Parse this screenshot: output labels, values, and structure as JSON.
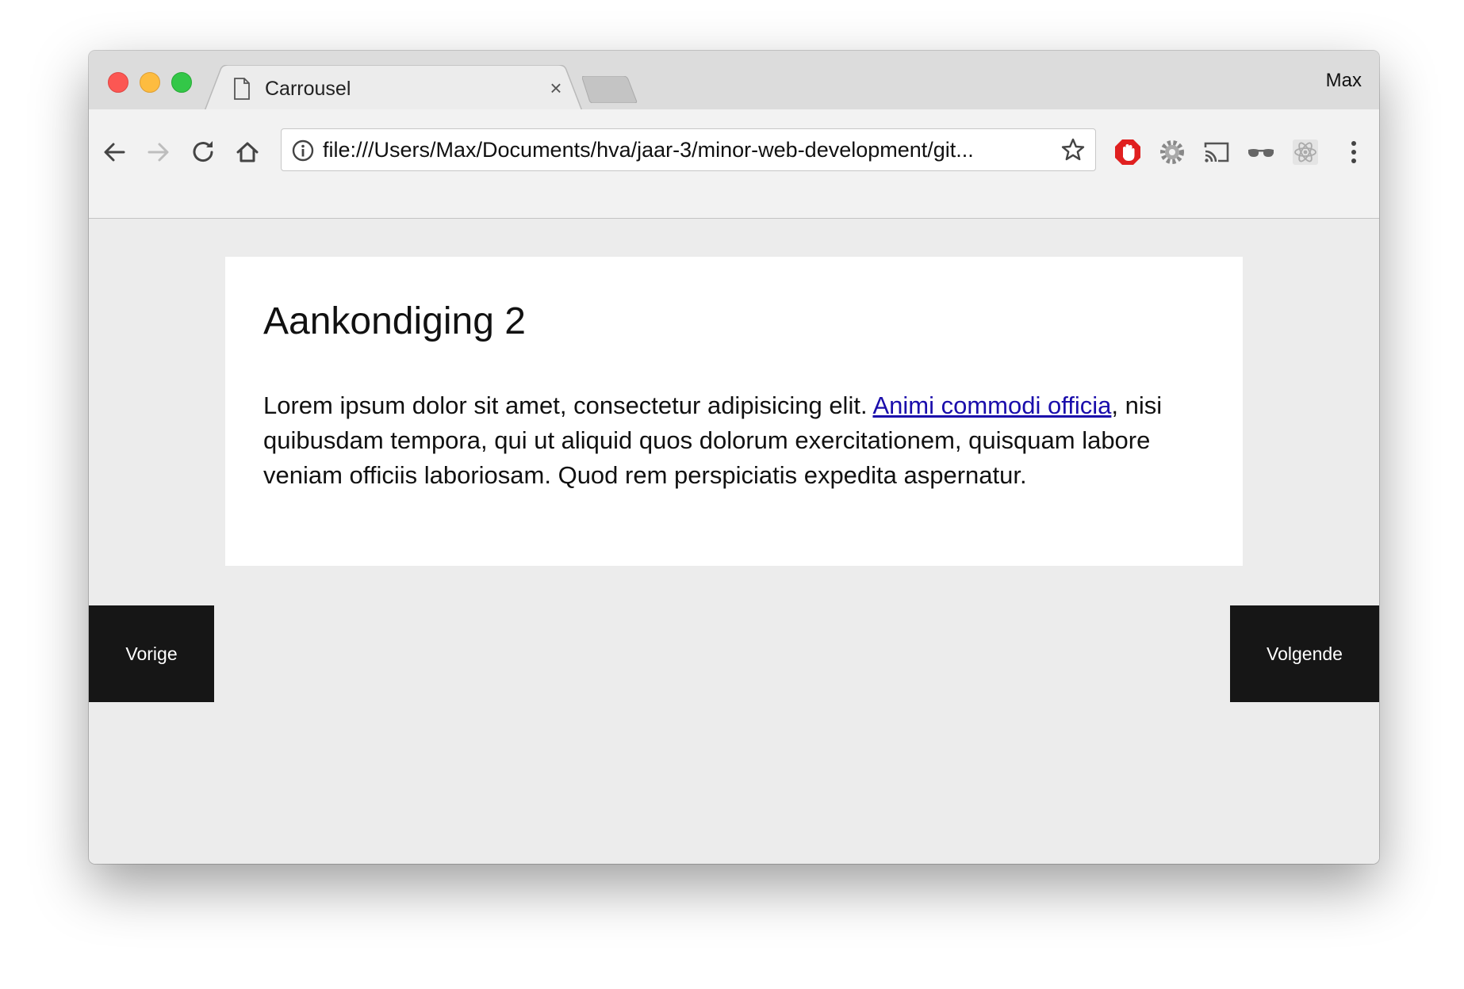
{
  "browser": {
    "tab": {
      "title": "Carrousel",
      "close_glyph": "×",
      "icon": "document-icon"
    },
    "profile": "Max",
    "url": "file:///Users/Max/Documents/hva/jaar-3/minor-web-development/git...",
    "nav_icons": [
      "back-arrow-icon",
      "forward-arrow-icon",
      "reload-icon",
      "home-icon"
    ],
    "extensions": [
      "adblock-icon",
      "gear-extension-icon",
      "cast-icon",
      "glasses-extension-icon",
      "react-devtools-icon"
    ],
    "colors": {
      "titlebar": "#dcdcdc",
      "toolbar": "#f2f2f2",
      "adblock": "#e02020"
    }
  },
  "page": {
    "card": {
      "title": "Aankondiging 2",
      "body_before_link": "Lorem ipsum dolor sit amet, consectetur adipisicing elit. ",
      "link_text": "Animi commodi officia",
      "body_after_link": ", nisi quibusdam tempora, qui ut aliquid quos dolorum exercitationem, quisquam labore veniam officiis laboriosam. Quod rem perspiciatis expedita aspernatur."
    },
    "controls": {
      "prev_label": "Vorige",
      "next_label": "Volgende"
    },
    "colors": {
      "background": "#ececec",
      "card": "#ffffff",
      "button": "#161616",
      "link": "#1a0dab"
    }
  }
}
